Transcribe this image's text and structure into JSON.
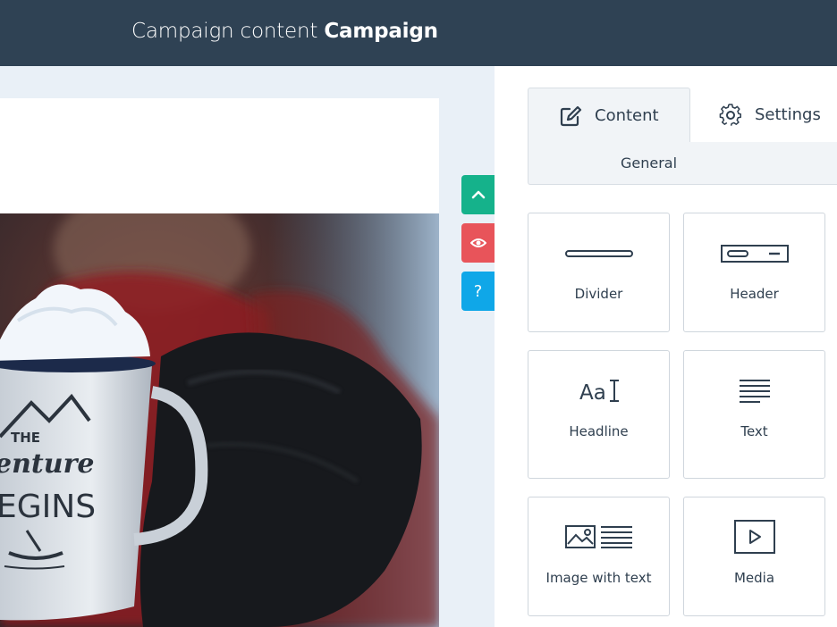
{
  "header": {
    "title_prefix": "Campaign content",
    "title_name": "Campaign"
  },
  "float_buttons": {
    "up_icon": "chevron-up-icon",
    "preview_icon": "eye-icon",
    "help_label": "?"
  },
  "panel": {
    "tabs": [
      {
        "label": "Content",
        "icon": "edit-icon",
        "active": true
      },
      {
        "label": "Settings",
        "icon": "gear-icon",
        "active": false
      }
    ],
    "subtab": "General",
    "blocks": [
      {
        "label": "Divider",
        "icon": "divider-icon"
      },
      {
        "label": "Header",
        "icon": "header-icon"
      },
      {
        "label": "Headline",
        "icon": "headline-icon",
        "icon_text": "Aa"
      },
      {
        "label": "Text",
        "icon": "text-lines-icon"
      },
      {
        "label": "Image with text",
        "icon": "image-with-text-icon"
      },
      {
        "label": "Media",
        "icon": "media-play-icon"
      }
    ]
  },
  "colors": {
    "topbar": "#2f4254",
    "accent_green": "#15b28b",
    "accent_red": "#e8545a",
    "accent_blue": "#0fa7e8"
  },
  "mug_text": {
    "line1": "THE",
    "line2": "enture",
    "line3": "EGINS"
  }
}
